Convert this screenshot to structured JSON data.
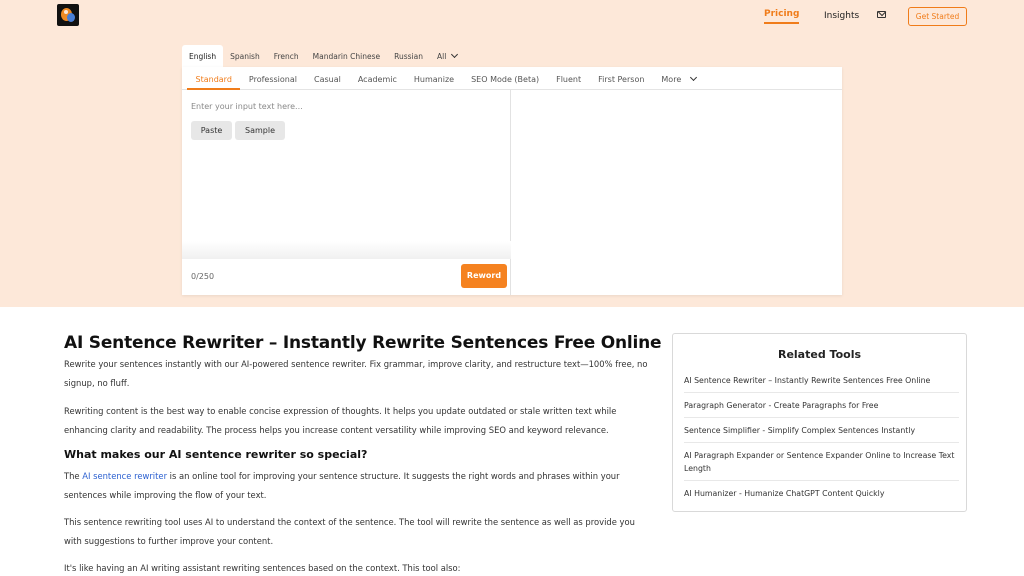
{
  "header": {
    "nav": {
      "pricing": "Pricing",
      "insights": "Insights"
    },
    "get_started": "Get Started",
    "icons": {
      "logo": "brand-logo",
      "mail": "mail-icon"
    },
    "colors": {
      "accent": "#f07c1a",
      "hero_bg": "#fde8d9"
    }
  },
  "languages": {
    "tabs": [
      "English",
      "Spanish",
      "French",
      "Mandarin Chinese",
      "Russian"
    ],
    "all": "All",
    "selected": "English"
  },
  "modes": {
    "tabs": [
      "Standard",
      "Professional",
      "Casual",
      "Academic",
      "Humanize",
      "SEO Mode (Beta)",
      "Fluent",
      "First Person"
    ],
    "more": "More",
    "selected": "Standard"
  },
  "editor": {
    "placeholder": "Enter your input text here...",
    "paste": "Paste",
    "sample": "Sample",
    "counter": "0/250",
    "reword": "Reword"
  },
  "article": {
    "title": "AI Sentence Rewriter – Instantly Rewrite Sentences Free Online",
    "intro": "Rewrite your sentences instantly with our AI-powered sentence rewriter. Fix grammar, improve clarity, and restructure text—100% free, no signup, no fluff.",
    "para2": "Rewriting content is the best way to enable concise expression of thoughts. It helps you update outdated or stale written text while enhancing clarity and readability. The process helps you increase content versatility while improving SEO and keyword relevance.",
    "heading2": "What makes our AI sentence rewriter so special?",
    "para3_pre": "The ",
    "para3_link": "AI sentence rewriter",
    "para3_post": " is an online tool for improving your sentence structure. It suggests the right words and phrases within your sentences while improving the flow of your text.",
    "para4": "This sentence rewriting tool uses AI to understand the context of the sentence. The tool will rewrite the sentence as well as provide you with suggestions to further improve your content.",
    "para5": "It's like having an AI writing assistant rewriting sentences based on the context. This tool also:"
  },
  "related": {
    "title": "Related Tools",
    "items": [
      "AI Sentence Rewriter – Instantly Rewrite Sentences Free Online",
      "Paragraph Generator - Create Paragraphs for Free",
      "Sentence Simplifier - Simplify Complex Sentences Instantly",
      "AI Paragraph Expander or Sentence Expander Online to Increase Text Length",
      "AI Humanizer - Humanize ChatGPT Content Quickly"
    ]
  }
}
